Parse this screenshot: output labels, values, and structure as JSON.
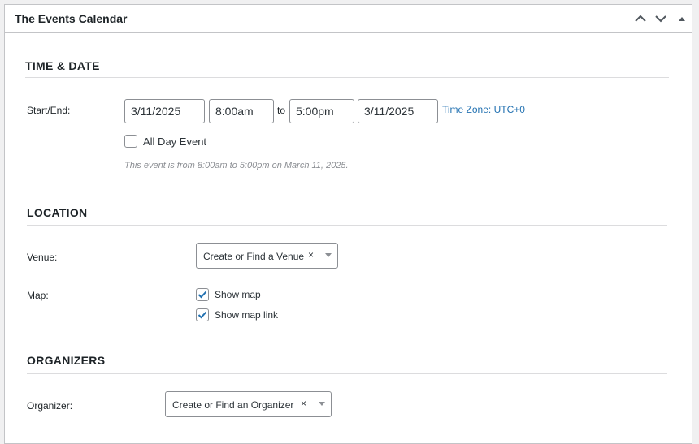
{
  "metabox": {
    "title": "The Events Calendar",
    "controls": {
      "up_icon": "chevron-up-icon",
      "down_icon": "chevron-down-icon",
      "toggle_icon": "triangle-up-icon"
    }
  },
  "time_date": {
    "heading": "TIME & DATE",
    "start_end_label": "Start/End:",
    "start_date": "3/11/2025",
    "start_time": "8:00am",
    "to_label": "to",
    "end_time": "5:00pm",
    "end_date": "3/11/2025",
    "timezone_link": "Time Zone: UTC+0",
    "all_day_label": "All Day Event",
    "all_day_checked": false,
    "summary": "This event is from 8:00am to 5:00pm on March 11, 2025."
  },
  "location": {
    "heading": "LOCATION",
    "venue_label": "Venue:",
    "venue_placeholder": "Create or Find a Venue",
    "clear_glyph": "×",
    "map_label": "Map:",
    "show_map_label": "Show map",
    "show_map_checked": true,
    "show_map_link_label": "Show map link",
    "show_map_link_checked": true
  },
  "organizers": {
    "heading": "ORGANIZERS",
    "organizer_label": "Organizer:",
    "organizer_placeholder": "Create or Find an Organizer",
    "clear_glyph": "×"
  },
  "colors": {
    "accent": "#2271b1",
    "border": "#8c8f94",
    "check": "#2271b1"
  }
}
